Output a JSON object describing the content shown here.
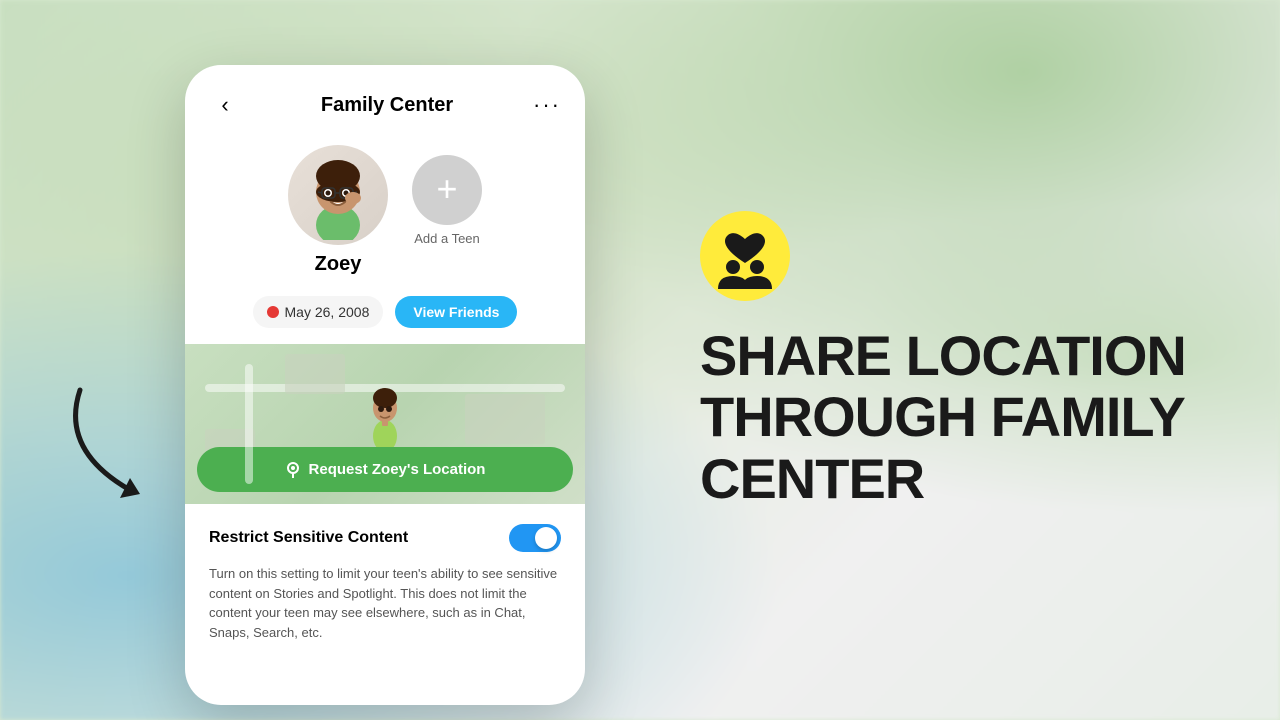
{
  "background": {
    "color": "#d8e8d0"
  },
  "phone": {
    "header": {
      "back_label": "‹",
      "title": "Family Center",
      "more_label": "···"
    },
    "profile": {
      "name": "Zoey",
      "add_teen_label": "Add a Teen",
      "add_teen_icon": "+"
    },
    "info": {
      "birthday": "May 26, 2008",
      "view_friends_label": "View Friends"
    },
    "map": {
      "request_btn_label": "Request Zoey's Location"
    },
    "restrict": {
      "title": "Restrict Sensitive Content",
      "description": "Turn on this setting to limit your teen's ability to see sensitive content on Stories and Spotlight. This does not limit the content your teen may see elsewhere, such as in Chat, Snaps, Search, etc.",
      "toggle_on": true
    }
  },
  "right_panel": {
    "heading_line1": "SHARE LOCATION",
    "heading_line2": "THROUGH FAMILY CENTER"
  }
}
